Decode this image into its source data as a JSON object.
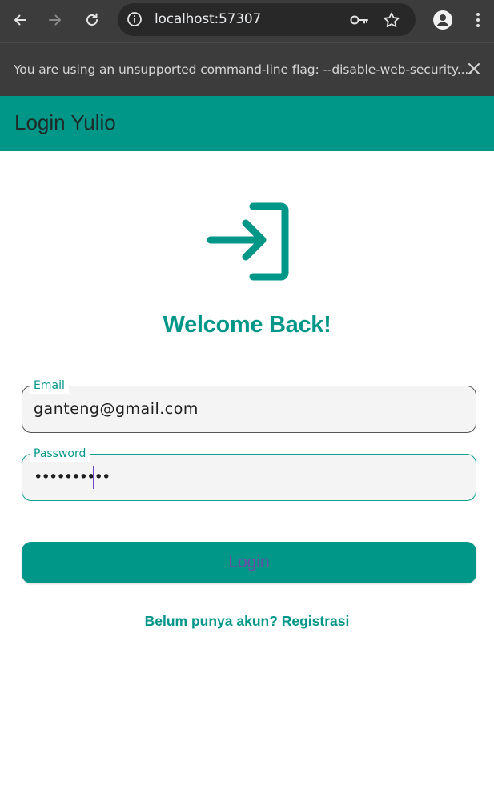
{
  "browser": {
    "url": "localhost:57307",
    "infobar_text": "You are using an unsupported command-line flag: --disable-web-security....",
    "icons": {
      "back": "arrow-left-icon",
      "forward": "arrow-right-icon",
      "reload": "reload-icon",
      "site_info": "info-icon",
      "password_key": "key-icon",
      "bookmark": "star-icon",
      "profile": "profile-icon",
      "menu": "kebab-menu-icon",
      "close": "close-icon"
    }
  },
  "appbar": {
    "title": "Login Yulio",
    "color": "#009688"
  },
  "main": {
    "icon": "login-icon",
    "heading": "Welcome Back!",
    "email_field": {
      "label": "Email",
      "value": "ganteng@gmail.com"
    },
    "password_field": {
      "label": "Password",
      "value": "••••••••••"
    },
    "login_button": "Login",
    "register_link": "Belum punya akun? Registrasi"
  },
  "colors": {
    "primary": "#009688",
    "caret": "#6a47c6",
    "button_text": "#6f4aa5"
  }
}
